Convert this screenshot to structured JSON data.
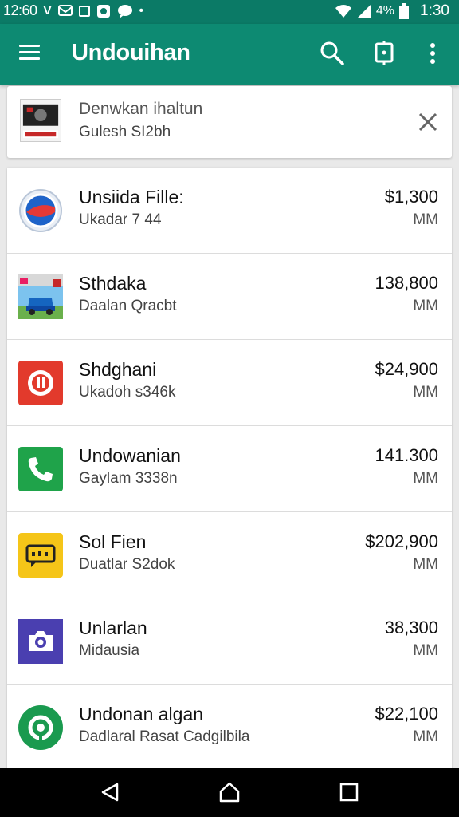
{
  "status_bar": {
    "time_left": "12:60",
    "carrier": "V",
    "battery_percent": "4%",
    "clock": "1:30"
  },
  "app_bar": {
    "title": "Undouihan",
    "icons": [
      "menu-icon",
      "search-icon",
      "device-frame-icon",
      "overflow-menu-icon"
    ]
  },
  "banner": {
    "title": "Denwkan ihaltun",
    "subtitle": "Gulesh SI2bh",
    "icon": "close-icon"
  },
  "list": [
    {
      "title": "Unsiida Fille:",
      "subtitle": "Ukadar 7 44",
      "price": "$1,300",
      "unit": "MM",
      "icon": "circle-app-icon",
      "color": "#1e63c9"
    },
    {
      "title": "Sthdaka",
      "subtitle": "Daalan Qracbt",
      "price": "138,800",
      "unit": "MM",
      "icon": "car-photo-icon",
      "color": "#2a8ed8"
    },
    {
      "title": "Shdghani",
      "subtitle": "Ukadoh s346k",
      "price": "$24,900",
      "unit": "MM",
      "icon": "red-app-icon",
      "color": "#e23a2c"
    },
    {
      "title": "Undowanian",
      "subtitle": "Gaylam 3338n",
      "price": "141.300",
      "unit": "MM",
      "icon": "phone-icon",
      "color": "#1fa34a"
    },
    {
      "title": "Sol Fien",
      "subtitle": "Duatlar S2dok",
      "price": "$202,900",
      "unit": "MM",
      "icon": "chat-bubble-icon",
      "color": "#f5c518"
    },
    {
      "title": "Unlarlan",
      "subtitle": "Midausia",
      "price": "38,300",
      "unit": "MM",
      "icon": "camera-icon",
      "color": "#4a3fb0"
    },
    {
      "title": "Undonan algan",
      "subtitle": "Dadlaral Rasat Cadgilbila",
      "price": "$22,100",
      "unit": "MM",
      "icon": "green-ring-icon",
      "color": "#1a9a4f"
    }
  ],
  "nav_bar": {
    "icons": [
      "back-icon",
      "home-icon",
      "recents-icon"
    ]
  }
}
